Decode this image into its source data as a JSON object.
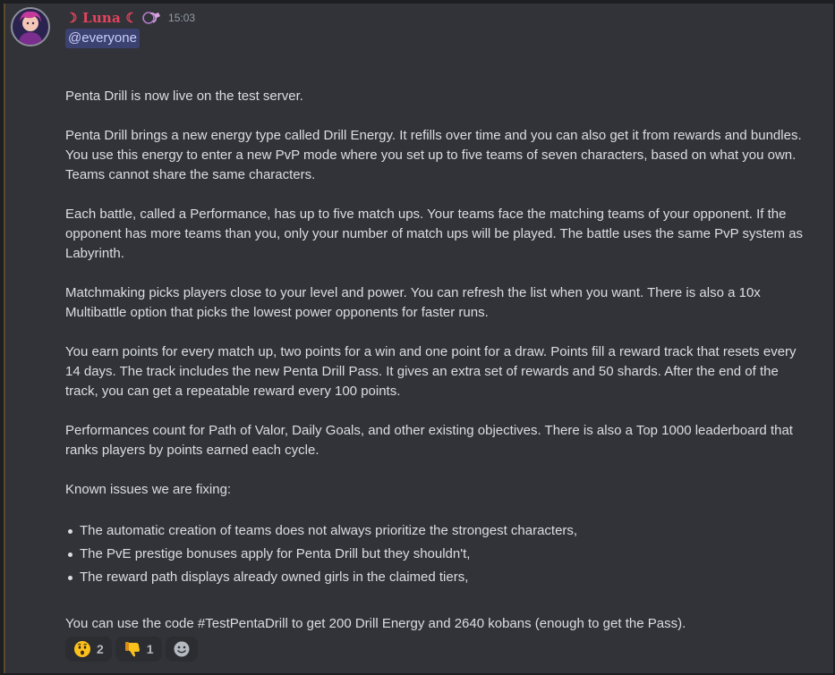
{
  "message": {
    "author": "☽ Luna ☾",
    "timestamp": "15:03",
    "mention": "@everyone",
    "paragraphs": [
      "Penta Drill is now live on the test server.",
      "Penta Drill brings a new energy type called Drill Energy. It refills over time and you can also get it from rewards and bundles. You use this energy to enter a new PvP mode where you set up to five teams of seven characters, based on what you own. Teams cannot share the same characters.",
      "Each battle, called a Performance, has up to five match ups. Your teams face the matching teams of your opponent. If the opponent has more teams than you, only your number of match ups will be played. The battle uses the same PvP system as Labyrinth.",
      "Matchmaking picks players close to your level and power. You can refresh the list when you want. There is also a 10x Multibattle option that picks the lowest power opponents for faster runs.",
      "You earn points for every match up, two points for a win and one point for a draw. Points fill a reward track that resets every 14 days. The track includes the new Penta Drill Pass. It gives an extra set of rewards and 50 shards. After the end of the track, you can get a repeatable reward every 100 points.",
      "Performances count for Path of Valor, Daily Goals, and other existing objectives. There is also a Top 1000 leaderboard that ranks players by points earned each cycle.",
      "Known issues we are fixing:"
    ],
    "issues": [
      "The automatic creation of teams does not always prioritize the strongest characters,",
      "The PvE prestige bonuses apply for Penta Drill but they shouldn't,",
      "The reward path displays already owned girls in the claimed tiers,"
    ],
    "code_line": "You can use the code #TestPentaDrill to get 200 Drill Energy and 2640 kobans (enough to get the Pass).",
    "reactions": [
      {
        "emoji": "hushed-face",
        "count": "2"
      },
      {
        "emoji": "thumbs-down",
        "count": "1"
      }
    ]
  },
  "colors": {
    "background": "#313338",
    "username": "#e8435e",
    "mention_bg": "#3c4270",
    "text": "#dbdee1"
  }
}
